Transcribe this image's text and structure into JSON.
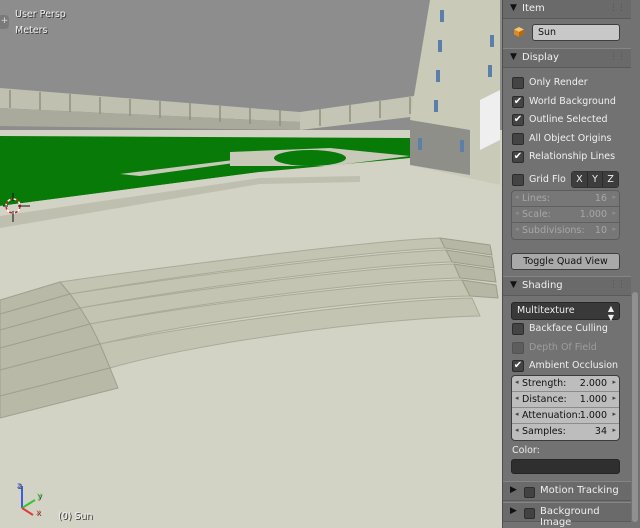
{
  "viewport": {
    "perspective_label": "User Persp",
    "units_label": "Meters",
    "object_label": "(0) Sun",
    "plus_icon": "plus-icon",
    "colors": {
      "sky": "#8d8d8d",
      "ground": "#d2d3c4",
      "lawn": "#087a08",
      "wall": "#c9cab8"
    }
  },
  "panel": {
    "item": {
      "title": "Item",
      "object_icon": "object-cube-icon",
      "object_name": "Sun"
    },
    "display": {
      "title": "Display",
      "options": [
        {
          "label": "Only Render",
          "checked": false
        },
        {
          "label": "World Background",
          "checked": true
        },
        {
          "label": "Outline Selected",
          "checked": true
        },
        {
          "label": "All Object Origins",
          "checked": false
        },
        {
          "label": "Relationship Lines",
          "checked": true
        }
      ],
      "grid_floor": {
        "label": "Grid Flo",
        "checked": false
      },
      "axes": [
        "X",
        "Y",
        "Z"
      ],
      "grid_fields": [
        {
          "label": "Lines:",
          "value": "16"
        },
        {
          "label": "Scale:",
          "value": "1.000"
        },
        {
          "label": "Subdivisions:",
          "value": "10"
        }
      ],
      "toggle_quad_view": "Toggle Quad View"
    },
    "shading": {
      "title": "Shading",
      "mode": "Multitexture",
      "options": [
        {
          "label": "Backface Culling",
          "checked": false,
          "enabled": true
        },
        {
          "label": "Depth Of Field",
          "checked": false,
          "enabled": false
        },
        {
          "label": "Ambient Occlusion",
          "checked": true,
          "enabled": true
        }
      ],
      "ao_fields": [
        {
          "label": "Strength:",
          "value": "2.000"
        },
        {
          "label": "Distance:",
          "value": "1.000"
        },
        {
          "label": "Attenuation:",
          "value": "1.000"
        },
        {
          "label": "Samples:",
          "value": "34"
        }
      ],
      "color_label": "Color:",
      "color_value": "#2f2f2f"
    },
    "motion_tracking": {
      "title": "Motion Tracking",
      "enabled": false
    },
    "background_images": {
      "title": "Background Image",
      "enabled": false
    }
  }
}
